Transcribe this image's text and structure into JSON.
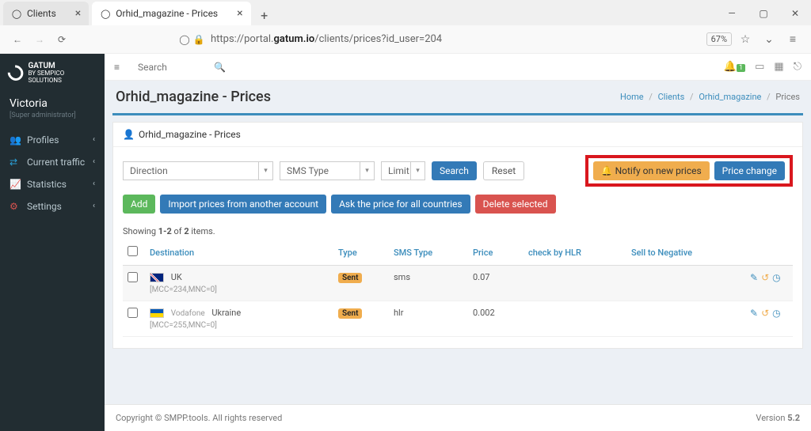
{
  "browser": {
    "tabs": [
      {
        "title": "Clients"
      },
      {
        "title": "Orhid_magazine - Prices"
      }
    ],
    "url_prefix": "https://portal.",
    "url_host": "gatum.io",
    "url_path": "/clients/prices?id_user=204",
    "zoom": "67%"
  },
  "brand": {
    "name": "GATUM",
    "sub": "BY SEMPICO SOLUTIONS"
  },
  "user": {
    "name": "Victoria",
    "role": "[Super administrator]"
  },
  "nav": {
    "profiles": "Profiles",
    "traffic": "Current traffic",
    "stats": "Statistics",
    "settings": "Settings"
  },
  "topbar": {
    "search_placeholder": "Search",
    "badge": "1"
  },
  "page": {
    "title": "Orhid_magazine - Prices",
    "crumbs": {
      "home": "Home",
      "clients": "Clients",
      "client": "Orhid_magazine",
      "current": "Prices"
    },
    "panel_title": "Orhid_magazine - Prices"
  },
  "filters": {
    "direction": "Direction",
    "sms_type": "SMS Type",
    "limit": "Limit",
    "search": "Search",
    "reset": "Reset",
    "notify": "Notify on new prices",
    "price_change": "Price change"
  },
  "actions": {
    "add": "Add",
    "import": "Import prices from another account",
    "ask": "Ask the price for all countries",
    "delete": "Delete selected"
  },
  "table": {
    "summary_pre": "Showing ",
    "summary_range": "1-2",
    "summary_mid": " of ",
    "summary_total": "2",
    "summary_post": " items.",
    "cols": {
      "dest": "Destination",
      "type": "Type",
      "smstype": "SMS Type",
      "price": "Price",
      "hlr": "check by HLR",
      "sell": "Sell to Negative"
    },
    "rows": [
      {
        "dest_main": "UK",
        "dest_meta": "[MCC=234,MNC=0]",
        "flag": "uk",
        "type": "Sent",
        "smstype": "sms",
        "price": "0.07",
        "operator": ""
      },
      {
        "dest_main": "Ukraine",
        "dest_meta": "[MCC=255,MNC=0]",
        "flag": "ua",
        "type": "Sent",
        "smstype": "hlr",
        "price": "0.002",
        "operator": "Vodafone"
      }
    ]
  },
  "footer": {
    "left": "Copyright © SMPP.tools. All rights reserved",
    "right_label": "Version ",
    "right_ver": "5.2"
  }
}
